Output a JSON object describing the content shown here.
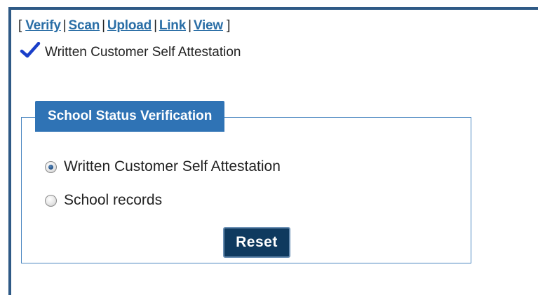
{
  "actions": {
    "open_bracket": "[",
    "close_bracket": "]",
    "separator": "|",
    "links": [
      {
        "label": "Verify"
      },
      {
        "label": "Scan"
      },
      {
        "label": "Upload"
      },
      {
        "label": "Link"
      },
      {
        "label": "View"
      }
    ]
  },
  "status": {
    "icon": "checkmark-icon",
    "text": "Written Customer Self Attestation",
    "icon_color": "#1a3fc9"
  },
  "verification": {
    "legend": "School Status Verification",
    "options": [
      {
        "label": "Written Customer Self Attestation",
        "checked": true
      },
      {
        "label": "School records",
        "checked": false
      }
    ],
    "reset_label": "Reset"
  },
  "colors": {
    "frame_border": "#2f5a86",
    "legend_bg": "#2f73b5",
    "button_bg": "#0f3a5f",
    "link": "#2a6ea6"
  }
}
